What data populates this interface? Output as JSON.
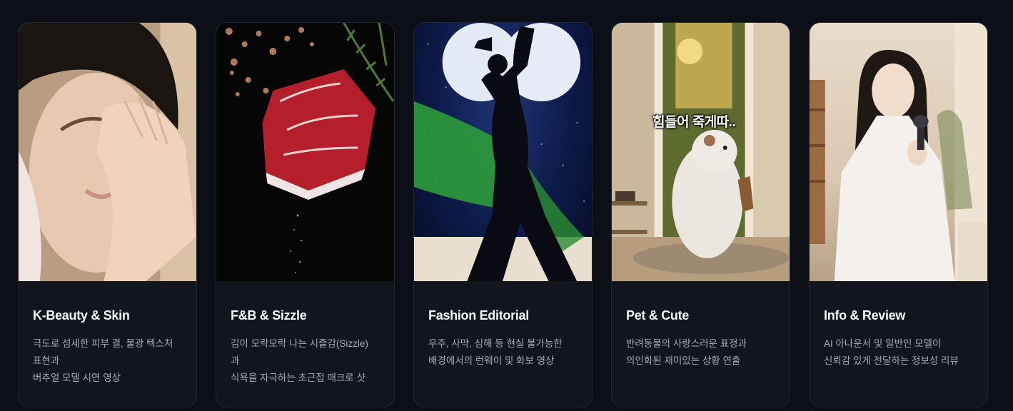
{
  "cards": [
    {
      "title": "K-Beauty & Skin",
      "description": "극도로 섬세한 피부 결, 물광 텍스처 표현과\n버추얼 모델 시연 영상",
      "image_icon": "face-skin-closeup"
    },
    {
      "title": "F&B & Sizzle",
      "description": "김이 모락모락 나는 시즐감(Sizzle)\n과\n식욕을 자극하는 초근접 매크로 샷",
      "image_icon": "floating-steak"
    },
    {
      "title": "Fashion Editorial",
      "description": "우주, 사막, 심해 등 현실 불가능한\n배경에서의 런웨이 및 화보 영상",
      "image_icon": "dancer-silhouette-moon"
    },
    {
      "title": "Pet & Cute",
      "description": "반려동물의 사랑스러운 표정과\n의인화된 재미있는 상황 연출",
      "image_icon": "hamster-doorway",
      "image_caption": "힘들어 죽게따.."
    },
    {
      "title": "Info & Review",
      "description": "AI 아나운서 및 일반인 모델이\n신뢰감 있게 전달하는 정보성 리뷰",
      "image_icon": "announcer-microphone"
    }
  ]
}
